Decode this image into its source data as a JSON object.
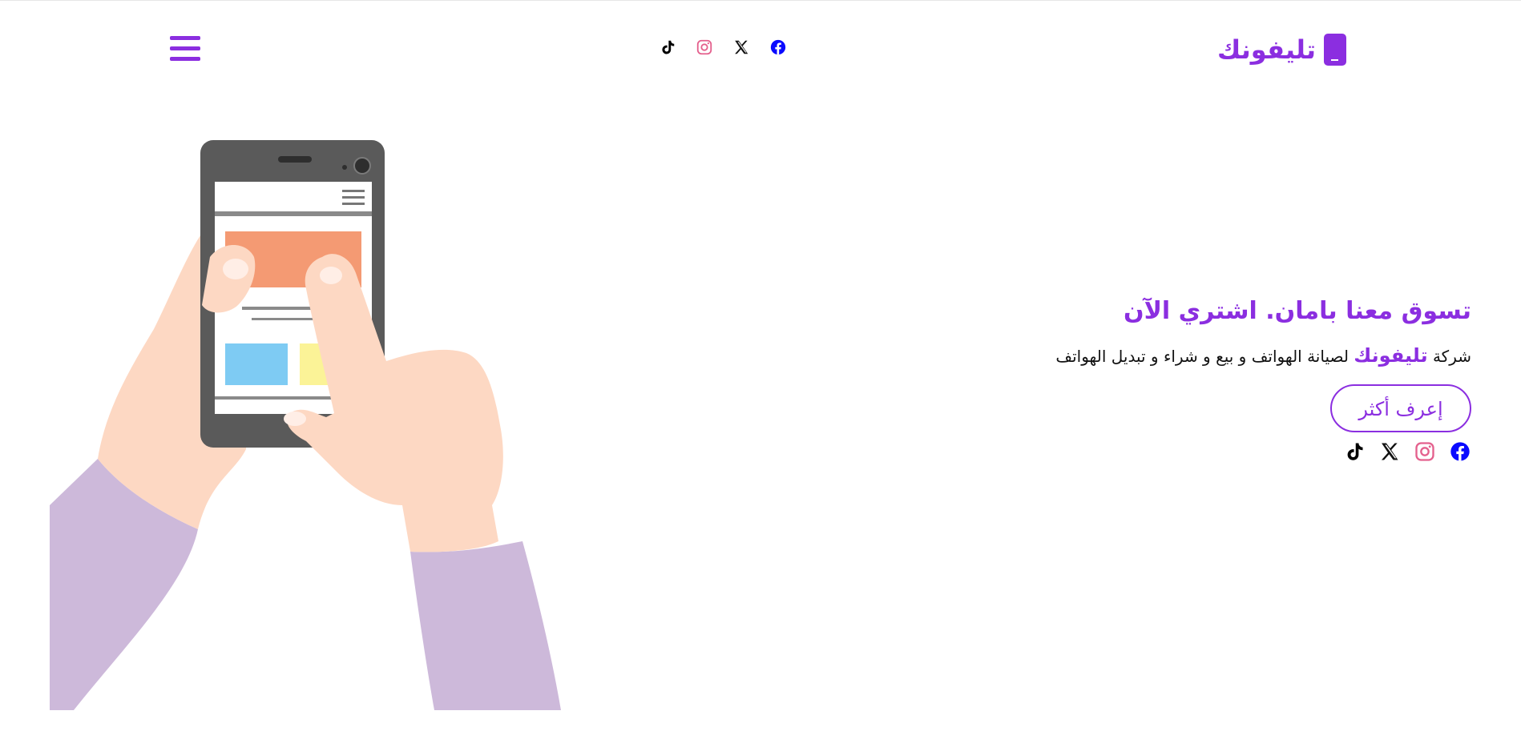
{
  "brand": {
    "name": "تليفونك",
    "color": "#8b2ee0"
  },
  "header": {
    "social": [
      {
        "name": "facebook-icon",
        "color": "#0a0aff"
      },
      {
        "name": "x-icon",
        "color": "#111111"
      },
      {
        "name": "instagram-icon",
        "color": "#e4608d"
      },
      {
        "name": "tiktok-icon",
        "color": "#000000"
      }
    ],
    "menu_icon": "hamburger-menu-icon"
  },
  "hero": {
    "title": "تسوق معنا بامان. اشتري الآن",
    "desc_prefix": "شركة",
    "desc_brand": "تليفونك",
    "desc_suffix": "لصيانة الهواتف و بيع و شراء و تبديل الهواتف",
    "cta_label": "إعرف أكثر",
    "social": [
      "facebook-icon",
      "instagram-icon",
      "x-icon",
      "tiktok-icon"
    ]
  },
  "illustration": {
    "name": "hands-holding-phone-illustration"
  },
  "colors": {
    "accent": "#8b2ee0",
    "facebook": "#0a0aff",
    "instagram": "#e4608d",
    "x": "#111111",
    "tiktok": "#000000"
  }
}
